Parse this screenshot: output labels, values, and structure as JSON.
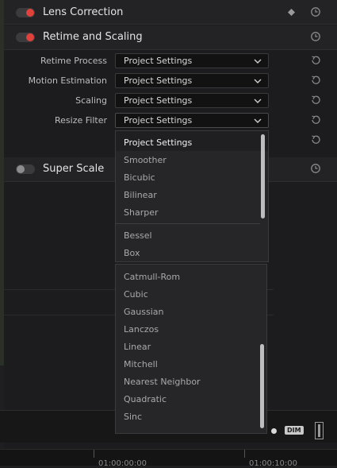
{
  "sections": {
    "lens_correction": {
      "title": "Lens Correction"
    },
    "retime": {
      "title": "Retime and Scaling"
    },
    "super_scale": {
      "title": "Super Scale"
    }
  },
  "rows": [
    {
      "label": "Retime Process",
      "value": "Project Settings"
    },
    {
      "label": "Motion Estimation",
      "value": "Project Settings"
    },
    {
      "label": "Scaling",
      "value": "Project Settings"
    },
    {
      "label": "Resize Filter",
      "value": "Project Settings"
    }
  ],
  "dropdown_top": {
    "options": [
      "Project Settings",
      "Smoother",
      "Bicubic",
      "Bilinear",
      "Sharper",
      "Bessel",
      "Box"
    ]
  },
  "dropdown_bottom": {
    "options": [
      "Catmull-Rom",
      "Cubic",
      "Gaussian",
      "Lanczos",
      "Linear",
      "Mitchell",
      "Nearest Neighbor",
      "Quadratic",
      "Sinc"
    ]
  },
  "bottom": {
    "dim_label": "DIM"
  },
  "ruler": {
    "tick1": "01:00:00:00",
    "tick2": "01:00:10:00"
  },
  "colors": {
    "accent_red": "#e0413a"
  },
  "icons": [
    "reset-icon",
    "keyframe-diamond-icon",
    "chevron-down-icon"
  ]
}
